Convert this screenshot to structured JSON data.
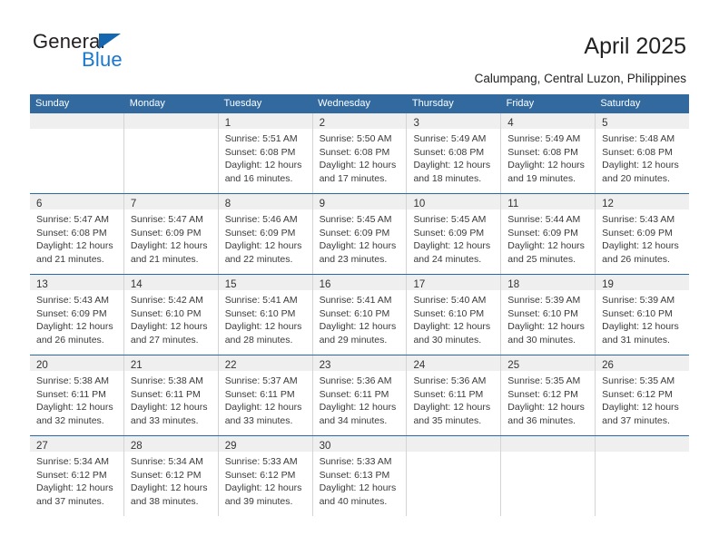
{
  "brand": {
    "name_part1": "General",
    "name_part2": "Blue",
    "logo_icon": "triangle-flag-icon"
  },
  "header": {
    "title": "April 2025",
    "subtitle": "Calumpang, Central Luzon, Philippines"
  },
  "colors": {
    "header_blue": "#32699f",
    "rule_blue": "#2869a8",
    "band_gray": "#efefef",
    "brand_blue": "#1878cf"
  },
  "calendar": {
    "weekdays": [
      "Sunday",
      "Monday",
      "Tuesday",
      "Wednesday",
      "Thursday",
      "Friday",
      "Saturday"
    ],
    "labels": {
      "sunrise": "Sunrise:",
      "sunset": "Sunset:",
      "daylight": "Daylight:"
    },
    "weeks": [
      [
        {
          "day": "",
          "sunrise": "",
          "sunset": "",
          "daylight": ""
        },
        {
          "day": "",
          "sunrise": "",
          "sunset": "",
          "daylight": ""
        },
        {
          "day": "1",
          "sunrise": "Sunrise: 5:51 AM",
          "sunset": "Sunset: 6:08 PM",
          "daylight": "Daylight: 12 hours and 16 minutes."
        },
        {
          "day": "2",
          "sunrise": "Sunrise: 5:50 AM",
          "sunset": "Sunset: 6:08 PM",
          "daylight": "Daylight: 12 hours and 17 minutes."
        },
        {
          "day": "3",
          "sunrise": "Sunrise: 5:49 AM",
          "sunset": "Sunset: 6:08 PM",
          "daylight": "Daylight: 12 hours and 18 minutes."
        },
        {
          "day": "4",
          "sunrise": "Sunrise: 5:49 AM",
          "sunset": "Sunset: 6:08 PM",
          "daylight": "Daylight: 12 hours and 19 minutes."
        },
        {
          "day": "5",
          "sunrise": "Sunrise: 5:48 AM",
          "sunset": "Sunset: 6:08 PM",
          "daylight": "Daylight: 12 hours and 20 minutes."
        }
      ],
      [
        {
          "day": "6",
          "sunrise": "Sunrise: 5:47 AM",
          "sunset": "Sunset: 6:08 PM",
          "daylight": "Daylight: 12 hours and 21 minutes."
        },
        {
          "day": "7",
          "sunrise": "Sunrise: 5:47 AM",
          "sunset": "Sunset: 6:09 PM",
          "daylight": "Daylight: 12 hours and 21 minutes."
        },
        {
          "day": "8",
          "sunrise": "Sunrise: 5:46 AM",
          "sunset": "Sunset: 6:09 PM",
          "daylight": "Daylight: 12 hours and 22 minutes."
        },
        {
          "day": "9",
          "sunrise": "Sunrise: 5:45 AM",
          "sunset": "Sunset: 6:09 PM",
          "daylight": "Daylight: 12 hours and 23 minutes."
        },
        {
          "day": "10",
          "sunrise": "Sunrise: 5:45 AM",
          "sunset": "Sunset: 6:09 PM",
          "daylight": "Daylight: 12 hours and 24 minutes."
        },
        {
          "day": "11",
          "sunrise": "Sunrise: 5:44 AM",
          "sunset": "Sunset: 6:09 PM",
          "daylight": "Daylight: 12 hours and 25 minutes."
        },
        {
          "day": "12",
          "sunrise": "Sunrise: 5:43 AM",
          "sunset": "Sunset: 6:09 PM",
          "daylight": "Daylight: 12 hours and 26 minutes."
        }
      ],
      [
        {
          "day": "13",
          "sunrise": "Sunrise: 5:43 AM",
          "sunset": "Sunset: 6:09 PM",
          "daylight": "Daylight: 12 hours and 26 minutes."
        },
        {
          "day": "14",
          "sunrise": "Sunrise: 5:42 AM",
          "sunset": "Sunset: 6:10 PM",
          "daylight": "Daylight: 12 hours and 27 minutes."
        },
        {
          "day": "15",
          "sunrise": "Sunrise: 5:41 AM",
          "sunset": "Sunset: 6:10 PM",
          "daylight": "Daylight: 12 hours and 28 minutes."
        },
        {
          "day": "16",
          "sunrise": "Sunrise: 5:41 AM",
          "sunset": "Sunset: 6:10 PM",
          "daylight": "Daylight: 12 hours and 29 minutes."
        },
        {
          "day": "17",
          "sunrise": "Sunrise: 5:40 AM",
          "sunset": "Sunset: 6:10 PM",
          "daylight": "Daylight: 12 hours and 30 minutes."
        },
        {
          "day": "18",
          "sunrise": "Sunrise: 5:39 AM",
          "sunset": "Sunset: 6:10 PM",
          "daylight": "Daylight: 12 hours and 30 minutes."
        },
        {
          "day": "19",
          "sunrise": "Sunrise: 5:39 AM",
          "sunset": "Sunset: 6:10 PM",
          "daylight": "Daylight: 12 hours and 31 minutes."
        }
      ],
      [
        {
          "day": "20",
          "sunrise": "Sunrise: 5:38 AM",
          "sunset": "Sunset: 6:11 PM",
          "daylight": "Daylight: 12 hours and 32 minutes."
        },
        {
          "day": "21",
          "sunrise": "Sunrise: 5:38 AM",
          "sunset": "Sunset: 6:11 PM",
          "daylight": "Daylight: 12 hours and 33 minutes."
        },
        {
          "day": "22",
          "sunrise": "Sunrise: 5:37 AM",
          "sunset": "Sunset: 6:11 PM",
          "daylight": "Daylight: 12 hours and 33 minutes."
        },
        {
          "day": "23",
          "sunrise": "Sunrise: 5:36 AM",
          "sunset": "Sunset: 6:11 PM",
          "daylight": "Daylight: 12 hours and 34 minutes."
        },
        {
          "day": "24",
          "sunrise": "Sunrise: 5:36 AM",
          "sunset": "Sunset: 6:11 PM",
          "daylight": "Daylight: 12 hours and 35 minutes."
        },
        {
          "day": "25",
          "sunrise": "Sunrise: 5:35 AM",
          "sunset": "Sunset: 6:12 PM",
          "daylight": "Daylight: 12 hours and 36 minutes."
        },
        {
          "day": "26",
          "sunrise": "Sunrise: 5:35 AM",
          "sunset": "Sunset: 6:12 PM",
          "daylight": "Daylight: 12 hours and 37 minutes."
        }
      ],
      [
        {
          "day": "27",
          "sunrise": "Sunrise: 5:34 AM",
          "sunset": "Sunset: 6:12 PM",
          "daylight": "Daylight: 12 hours and 37 minutes."
        },
        {
          "day": "28",
          "sunrise": "Sunrise: 5:34 AM",
          "sunset": "Sunset: 6:12 PM",
          "daylight": "Daylight: 12 hours and 38 minutes."
        },
        {
          "day": "29",
          "sunrise": "Sunrise: 5:33 AM",
          "sunset": "Sunset: 6:12 PM",
          "daylight": "Daylight: 12 hours and 39 minutes."
        },
        {
          "day": "30",
          "sunrise": "Sunrise: 5:33 AM",
          "sunset": "Sunset: 6:13 PM",
          "daylight": "Daylight: 12 hours and 40 minutes."
        },
        {
          "day": "",
          "sunrise": "",
          "sunset": "",
          "daylight": ""
        },
        {
          "day": "",
          "sunrise": "",
          "sunset": "",
          "daylight": ""
        },
        {
          "day": "",
          "sunrise": "",
          "sunset": "",
          "daylight": ""
        }
      ]
    ]
  }
}
